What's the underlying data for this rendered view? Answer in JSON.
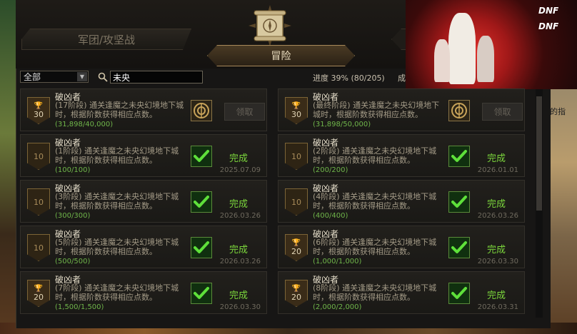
{
  "tabs": {
    "left": "军团/攻坚战",
    "active": "冒险"
  },
  "filter": {
    "selected": "全部"
  },
  "search": {
    "value": "未央"
  },
  "progress": {
    "label": "进度",
    "text": "39% (80/205)",
    "suffix": "成"
  },
  "side_text": "的指",
  "cards": [
    {
      "title": "破凶者",
      "desc": "(17阶段) 通关逢魔之未央幻境地下城时，根据阶数获得相应点数。",
      "progress": "(31,898/40,000)",
      "badge": "30",
      "trophy": true,
      "status": "claim",
      "claim_label": "领取",
      "date": ""
    },
    {
      "title": "破凶者",
      "desc": "(最终阶段) 通关逢魔之未央幻境地下城时，根据阶数获得相应点数。",
      "progress": "(31,898/50,000)",
      "badge": "30",
      "trophy": true,
      "status": "claim",
      "claim_label": "领取",
      "date": ""
    },
    {
      "title": "破凶者",
      "desc": "(1阶段) 通关逢魔之未央幻境地下城时，根据阶数获得相应点数。",
      "progress": "(100/100)",
      "badge": "10",
      "trophy": false,
      "status": "done",
      "done_label": "完成",
      "date": "2025.07.09"
    },
    {
      "title": "破凶者",
      "desc": "(2阶段) 通关逢魔之未央幻境地下城时，根据阶数获得相应点数。",
      "progress": "(200/200)",
      "badge": "10",
      "trophy": false,
      "status": "done",
      "done_label": "完成",
      "date": "2026.01.01"
    },
    {
      "title": "破凶者",
      "desc": "(3阶段) 通关逢魔之未央幻境地下城时，根据阶数获得相应点数。",
      "progress": "(300/300)",
      "badge": "10",
      "trophy": false,
      "status": "done",
      "done_label": "完成",
      "date": "2026.03.26"
    },
    {
      "title": "破凶者",
      "desc": "(4阶段) 通关逢魔之未央幻境地下城时，根据阶数获得相应点数。",
      "progress": "(400/400)",
      "badge": "10",
      "trophy": false,
      "status": "done",
      "done_label": "完成",
      "date": "2026.03.26"
    },
    {
      "title": "破凶者",
      "desc": "(5阶段) 通关逢魔之未央幻境地下城时，根据阶数获得相应点数。",
      "progress": "(500/500)",
      "badge": "10",
      "trophy": false,
      "status": "done",
      "done_label": "完成",
      "date": "2026.03.26"
    },
    {
      "title": "破凶者",
      "desc": "(6阶段) 通关逢魔之未央幻境地下城时，根据阶数获得相应点数。",
      "progress": "(1,000/1,000)",
      "badge": "20",
      "trophy": true,
      "status": "done",
      "done_label": "完成",
      "date": "2026.03.30"
    },
    {
      "title": "破凶者",
      "desc": "(7阶段) 通关逢魔之未央幻境地下城时，根据阶数获得相应点数。",
      "progress": "(1,500/1,500)",
      "badge": "20",
      "trophy": true,
      "status": "done",
      "done_label": "完成",
      "date": "2026.03.30"
    },
    {
      "title": "破凶者",
      "desc": "(8阶段) 通关逢魔之未央幻境地下城时，根据阶数获得相应点数。",
      "progress": "(2,000/2,000)",
      "badge": "20",
      "trophy": true,
      "status": "done",
      "done_label": "完成",
      "date": "2026.03.31"
    }
  ],
  "colors": {
    "done_green": "#7bd63c",
    "progress_green": "#6fb54a",
    "gold_border": "#a8895a"
  }
}
